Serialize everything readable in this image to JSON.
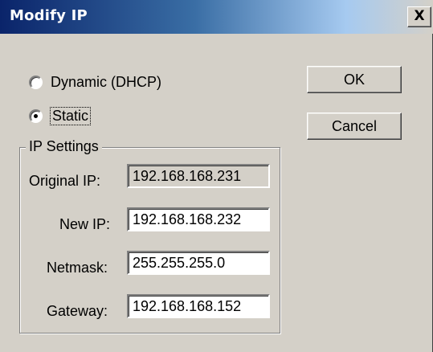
{
  "window": {
    "title": "Modify IP",
    "close_glyph": "X"
  },
  "mode": {
    "dynamic_label": "Dynamic (DHCP)",
    "static_label": "Static",
    "selected": "static"
  },
  "buttons": {
    "ok_label": "OK",
    "cancel_label": "Cancel"
  },
  "ip_settings": {
    "group_label": "IP Settings",
    "original_ip_label": "Original IP:",
    "original_ip_value": "192.168.168.231",
    "new_ip_label": "New IP:",
    "new_ip_value": "192.168.168.232",
    "netmask_label": "Netmask:",
    "netmask_value": "255.255.255.0",
    "gateway_label": "Gateway:",
    "gateway_value": "192.168.168.152"
  }
}
